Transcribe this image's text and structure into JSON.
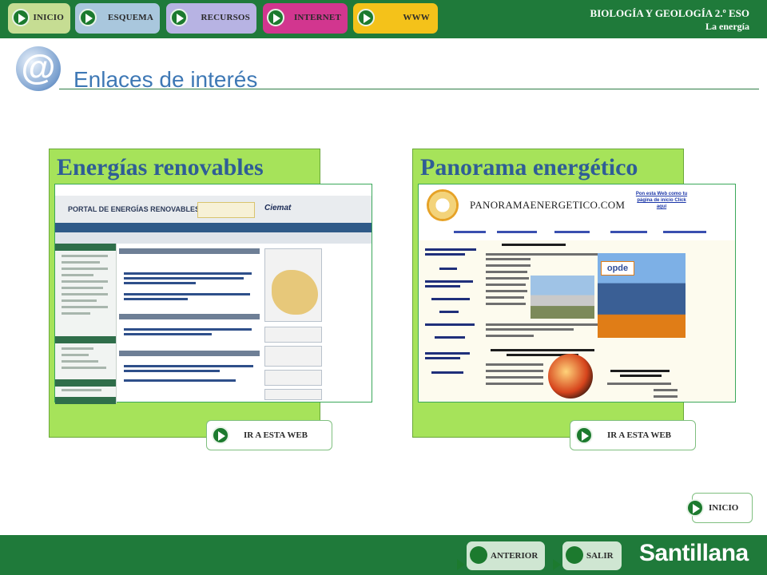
{
  "topnav": {
    "items": [
      {
        "label": "INICIO",
        "color": "#c6dd93"
      },
      {
        "label": "ESQUEMA",
        "color": "#a9c7dd"
      },
      {
        "label": "RECURSOS",
        "color": "#b7b3e3"
      },
      {
        "label": "INTERNET",
        "color": "#d2368f"
      },
      {
        "label": "WWW",
        "color": "#f4c21a"
      }
    ]
  },
  "subject": {
    "title": "BIOLOGÍA Y GEOLOGÍA 2.º ESO",
    "subtitle": "La energía"
  },
  "page": {
    "title": "Enlaces de interés",
    "icon": "at-sign-icon"
  },
  "cards": [
    {
      "title": "Energías renovables",
      "button_label": "IR A ESTA WEB",
      "screenshot": {
        "banner_title": "PORTAL DE ENERGÍAS RENOVABLES",
        "partner_logo": "Ciemat"
      }
    },
    {
      "title": "Panorama energético",
      "button_label": "IR A ESTA WEB",
      "screenshot": {
        "site_name": "PANORAMAENERGETICO.COM",
        "web_note": "Pon esta Web como tu página de inicio Click aquí",
        "ad_brand": "opde"
      }
    }
  ],
  "bottom": {
    "home_label": "INICIO",
    "prev_label": "ANTERIOR",
    "exit_label": "SALIR",
    "brand": "Santillana"
  },
  "colors": {
    "bar": "#1f7a3a",
    "panel": "#a6e35a",
    "title_blue": "#3e78b5"
  }
}
